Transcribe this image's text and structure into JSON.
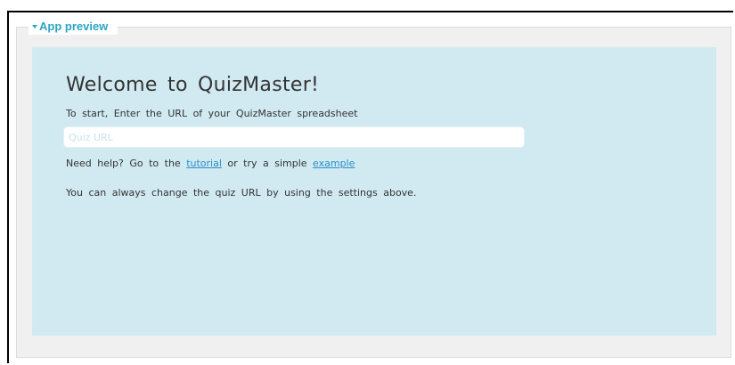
{
  "section": {
    "legend_label": "App preview"
  },
  "app": {
    "welcome_title": "Welcome to QuizMaster!",
    "instructions": "To start, Enter the URL of your QuizMaster spreadsheet",
    "quiz_url_input": {
      "value": "",
      "placeholder": "Quiz URL"
    },
    "help": {
      "prefix": "Need help? Go to the ",
      "tutorial_link": "tutorial",
      "middle": " or try a simple ",
      "example_link": "example"
    },
    "change_note": "You can always change the quiz URL by using the settings above."
  },
  "colors": {
    "accent": "#2ba6c2",
    "preview_background": "#d1eaf1",
    "link": "#2a8fc7"
  }
}
